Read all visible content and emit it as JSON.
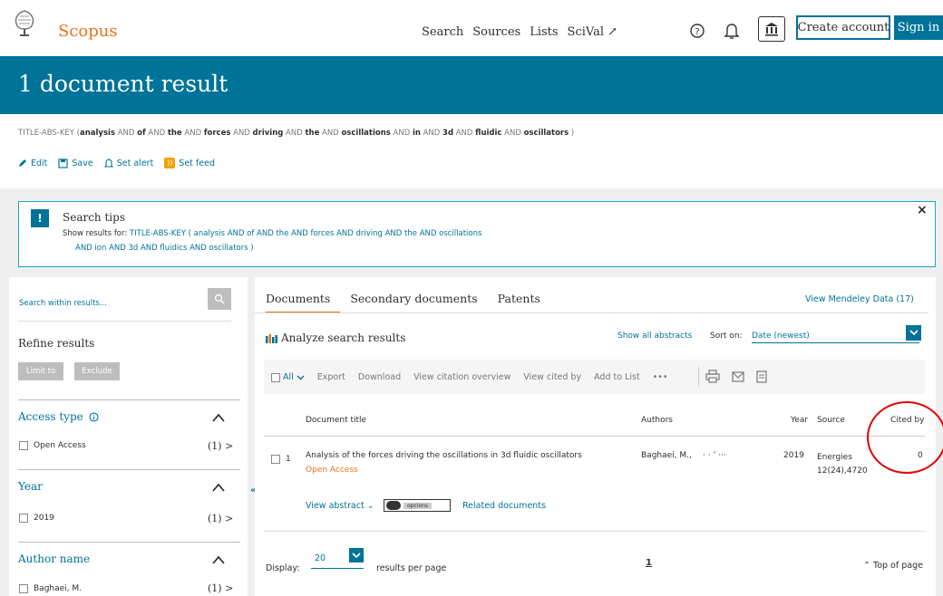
{
  "header": {
    "brand": "Scopus",
    "nav": [
      "Search",
      "Sources",
      "Lists",
      "SciVal ↗"
    ],
    "create_account": "Create account",
    "sign_in": "Sign in",
    "icons": [
      "help-icon",
      "bell-icon",
      "institution-icon"
    ]
  },
  "banner": {
    "title": "1 document result"
  },
  "query": {
    "prefix": "TITLE-ABS-KEY (",
    "tokens": [
      {
        "t": "analysis",
        "b": true
      },
      {
        "t": " AND ",
        "b": false
      },
      {
        "t": "of",
        "b": true
      },
      {
        "t": " AND ",
        "b": false
      },
      {
        "t": "the",
        "b": true
      },
      {
        "t": " AND ",
        "b": false
      },
      {
        "t": "forces",
        "b": true
      },
      {
        "t": " AND ",
        "b": false
      },
      {
        "t": "driving",
        "b": true
      },
      {
        "t": " AND ",
        "b": false
      },
      {
        "t": "the",
        "b": true
      },
      {
        "t": " AND ",
        "b": false
      },
      {
        "t": "oscillations",
        "b": true
      },
      {
        "t": " AND ",
        "b": false
      },
      {
        "t": "in",
        "b": true
      },
      {
        "t": " AND ",
        "b": false
      },
      {
        "t": "3d",
        "b": true
      },
      {
        "t": " AND ",
        "b": false
      },
      {
        "t": "fluidic",
        "b": true
      },
      {
        "t": " AND ",
        "b": false
      },
      {
        "t": "oscillators",
        "b": true
      }
    ],
    "suffix": " )"
  },
  "actions": {
    "edit": "Edit",
    "save": "Save",
    "set_alert": "Set alert",
    "set_feed": "Set feed"
  },
  "tips": {
    "badge": "!",
    "title": "Search tips",
    "show_label": "Show results for:",
    "line1": "TITLE-ABS-KEY ( analysis  AND of  AND the  AND forces  AND driving  AND the  AND oscillations",
    "line2": "AND ion  AND 3d  AND fluidics  AND oscillators )",
    "close": "×"
  },
  "sidebar": {
    "search_placeholder": "Search within results...",
    "refine": "Refine results",
    "limit_to": "Limit to",
    "exclude": "Exclude",
    "facets": [
      {
        "title": "Access type",
        "item": "Open Access",
        "count": "(1) >"
      },
      {
        "title": "Year",
        "item": "2019",
        "count": "(1) >"
      },
      {
        "title": "Author name",
        "item": "Baghaei, M.",
        "count": "(1) >"
      }
    ]
  },
  "tabs": [
    "Documents",
    "Secondary documents",
    "Patents"
  ],
  "mendeley": "View Mendeley Data (17)",
  "analyze": "Analyze search results",
  "show_all_abstracts": "Show all abstracts",
  "sort": {
    "label": "Sort on:",
    "value": "Date (newest)"
  },
  "toolbar": {
    "all": "All",
    "items": [
      "Export",
      "Download",
      "View citation overview",
      "View cited by",
      "Add to List",
      "•••"
    ]
  },
  "columns": {
    "title": "Document title",
    "authors": "Authors",
    "year": "Year",
    "source": "Source",
    "cited_by": "Cited by"
  },
  "result": {
    "num": "1",
    "title": "Analysis of the forces driving the oscillations in 3d fluidic oscillators",
    "access": "Open Access",
    "authors": "Baghaei, M.,     · · ’ ···",
    "year": "2019",
    "source_line1": "Energies",
    "source_line2": "12(24),4720",
    "cited_by": "0",
    "view_abstract": "View abstract",
    "badge_text": "opcions",
    "related": "Related documents"
  },
  "footer": {
    "display": "Display:",
    "per_page_value": "20",
    "results_per_page": "results per page",
    "page": "1",
    "top_of_page": "Top of page"
  },
  "colors": {
    "brand_blue": "#007398",
    "brand_orange": "#e9711c",
    "annotation_red": "#e00000"
  }
}
